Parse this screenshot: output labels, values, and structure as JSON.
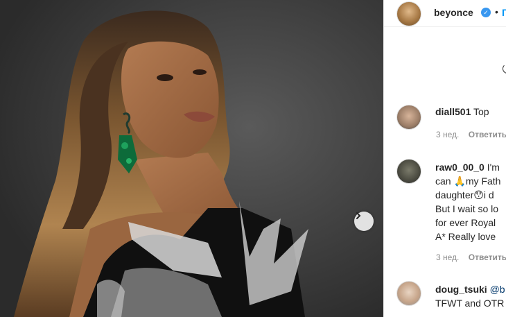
{
  "post": {
    "author": "beyonce",
    "follow_label": "П",
    "separator": "•"
  },
  "photo": {
    "next_button_icon": "chevron-right-icon"
  },
  "comments": [
    {
      "username": "diall501",
      "lines": [
        "Top"
      ],
      "time": "3 нед.",
      "reply_label": "Ответить"
    },
    {
      "username": "raw0_00_0",
      "lines": [
        "I'm",
        "can 🙏my Fath",
        "daughter😯i d",
        "But I wait so lo",
        "for ever Royal",
        "A* Really love"
      ],
      "time": "3 нед.",
      "reply_label": "Ответить"
    },
    {
      "username": "doug_tsuki",
      "lines": [
        "@b",
        "TFWT and OTR"
      ],
      "time": "",
      "reply_label": ""
    }
  ],
  "colors": {
    "link": "#0095f6",
    "verified": "#3897f0",
    "meta": "#8e8e8e"
  }
}
